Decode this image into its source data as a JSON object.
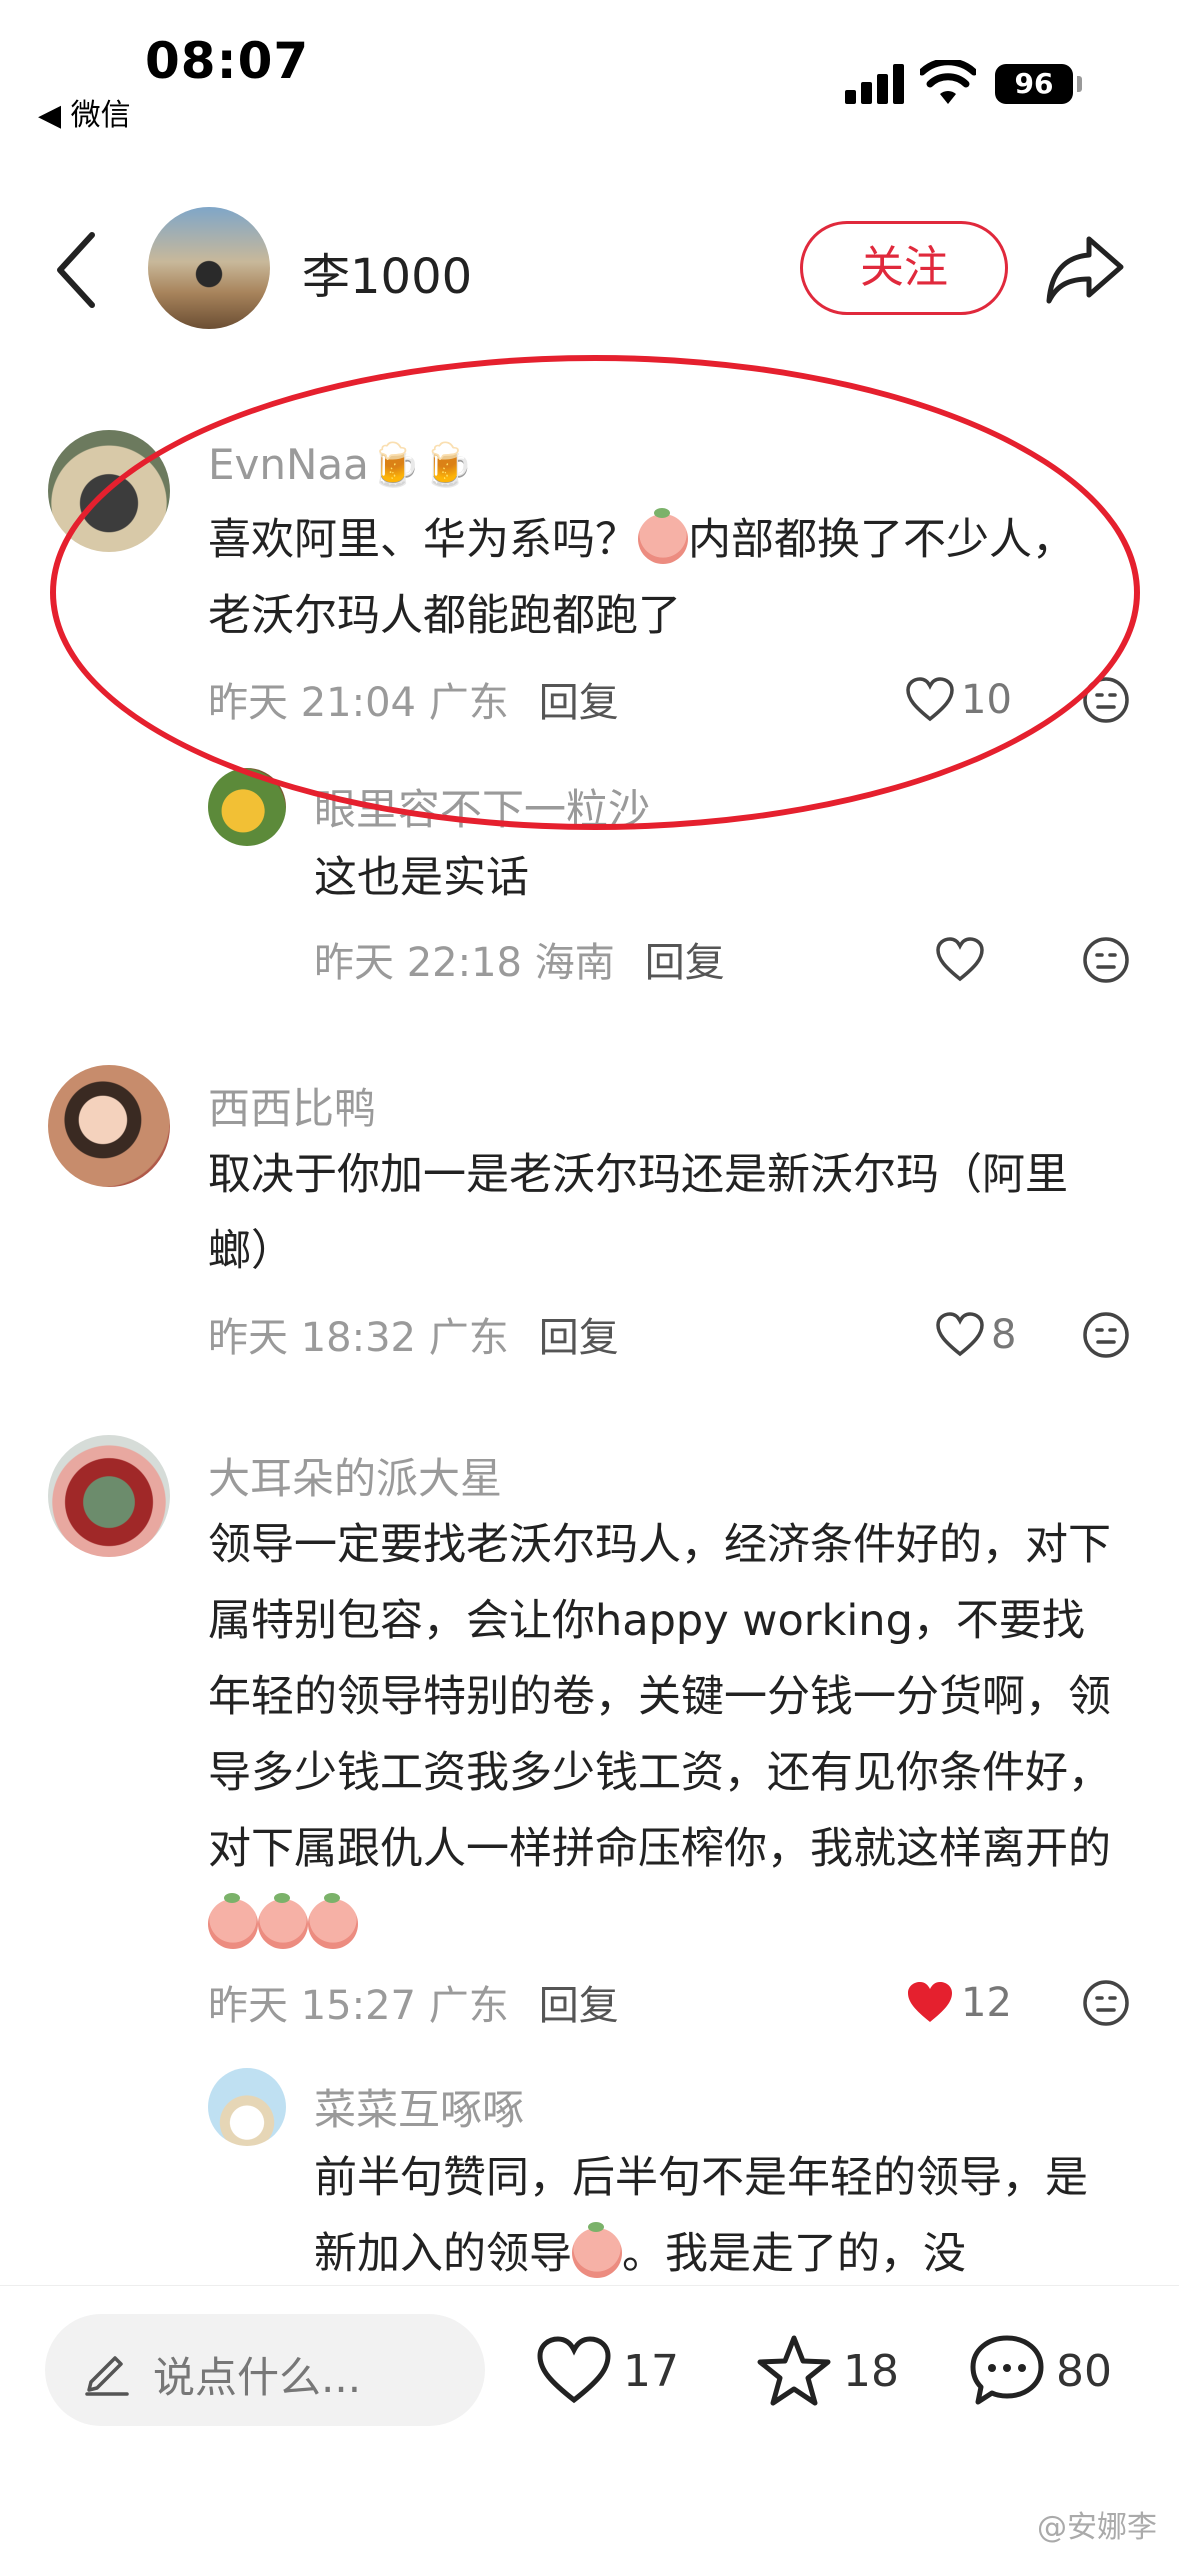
{
  "status_bar": {
    "time": "08:07",
    "back_app": "◀ 微信",
    "battery": "96"
  },
  "header": {
    "username": "李1000",
    "follow_label": "关注"
  },
  "comments": [
    {
      "name": "EvnNaa🍺🍺",
      "text_before": "喜欢阿里、华为系吗？",
      "text_after": "内部都换了不少人，老沃尔玛人都能跑都跑了",
      "meta": "昨天 21:04 广东",
      "reply": "回复",
      "likes": "10",
      "liked": false
    },
    {
      "name": "眼里容不下一粒沙",
      "text": "这也是实话",
      "meta": "昨天 22:18 海南",
      "reply": "回复",
      "likes": "",
      "liked": false
    },
    {
      "name": "西西比鸭",
      "text": "取决于你加一是老沃尔玛还是新沃尔玛（阿里螂）",
      "meta": "昨天 18:32 广东",
      "reply": "回复",
      "likes": "8",
      "liked": false
    },
    {
      "name": "大耳朵的派大星",
      "text": "领导一定要找老沃尔玛人，经济条件好的，对下属特别包容，会让你happy working，不要找年轻的领导特别的卷，关键一分钱一分货啊，领导多少钱工资我多少钱工资，还有见你条件好，对下属跟仇人一样拼命压榨你，我就这样离开的",
      "meta": "昨天 15:27 广东",
      "reply": "回复",
      "likes": "12",
      "liked": true
    },
    {
      "name": "菜菜互啄啄",
      "text_before": "前半句赞同，后半句不是年轻的领导，是新加入的领导",
      "text_after": "。我是走了的，没"
    }
  ],
  "bottom_bar": {
    "input_placeholder": "说点什么...",
    "likes": "17",
    "stars": "18",
    "comments": "80"
  },
  "watermark": "@安娜李",
  "colors": {
    "accent": "#e0293c",
    "like_red": "#e5202e",
    "gray_text": "#9a9a9a"
  }
}
